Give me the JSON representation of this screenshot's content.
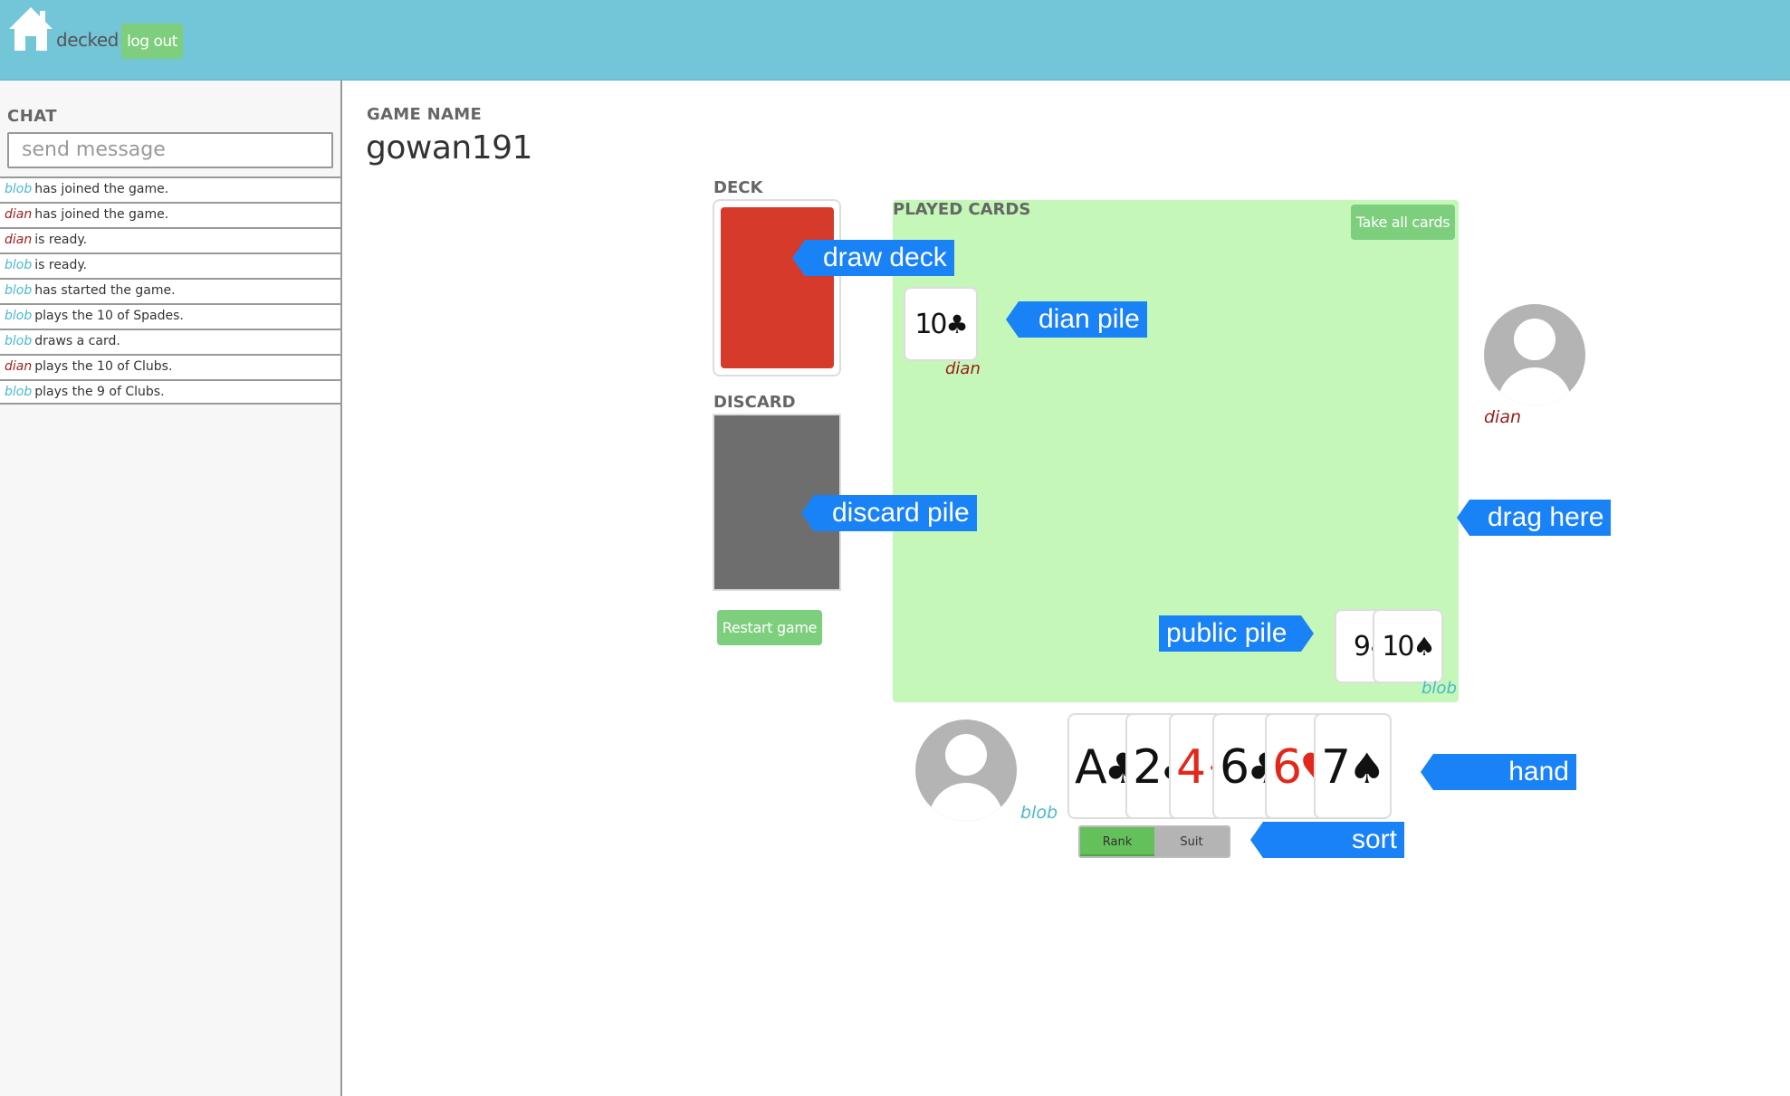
{
  "topbar": {
    "brand": "decked",
    "logout_label": "log out",
    "home_icon": "home-icon"
  },
  "chat": {
    "label": "CHAT",
    "placeholder": "send message",
    "messages": [
      {
        "user": "blob",
        "text": "has joined the game."
      },
      {
        "user": "dian",
        "text": "has joined the game."
      },
      {
        "user": "dian",
        "text": "is ready."
      },
      {
        "user": "blob",
        "text": "is ready."
      },
      {
        "user": "blob",
        "text": "has started the game."
      },
      {
        "user": "blob",
        "text": "plays the 10 of Spades."
      },
      {
        "user": "blob",
        "text": "draws a card."
      },
      {
        "user": "dian",
        "text": "plays the 10 of Clubs."
      },
      {
        "user": "blob",
        "text": "plays the 9 of Clubs."
      }
    ]
  },
  "game": {
    "name_label": "GAME NAME",
    "name": "gowan191"
  },
  "deck": {
    "label": "DECK"
  },
  "discard": {
    "label": "DISCARD",
    "restart_label": "Restart game"
  },
  "played": {
    "label": "PLAYED CARDS",
    "take_all_label": "Take all cards",
    "dian_pile": {
      "owner": "dian",
      "cards": [
        {
          "rank": "10",
          "suit": "♣"
        }
      ]
    },
    "public_pile": {
      "owner": "blob",
      "cards": [
        {
          "rank": "9",
          "suit": "♣"
        },
        {
          "rank": "10",
          "suit": "♠"
        }
      ]
    }
  },
  "players": {
    "opponent": "dian",
    "self": "blob"
  },
  "hand": {
    "cards": [
      {
        "rank": "A",
        "suit": "♣",
        "color": "black"
      },
      {
        "rank": "2",
        "suit": "♣",
        "color": "black"
      },
      {
        "rank": "4",
        "suit": "♦",
        "color": "red"
      },
      {
        "rank": "6",
        "suit": "♣",
        "color": "black"
      },
      {
        "rank": "6",
        "suit": "♥",
        "color": "red"
      },
      {
        "rank": "7",
        "suit": "♠",
        "color": "black"
      }
    ],
    "sort_options": [
      "Rank",
      "Suit"
    ],
    "sort_active": "Rank"
  },
  "annotations": {
    "draw_deck": "draw  deck",
    "dian_pile": "dian pile",
    "discard_pile": "discard pile",
    "drag_here": "drag here",
    "public_pile": "public pile",
    "hand": "hand",
    "sort": "sort"
  },
  "colors": {
    "topbar": "#73c5d8",
    "button_green": "#7dcf7d",
    "played_area": "#c4f7b8",
    "deck_back": "#d63a2b",
    "discard": "#6e6e6e",
    "callout": "#1a82f7",
    "blob": "#4ab8cf",
    "dian": "#9b1c1c",
    "red_suit": "#e3271b"
  }
}
